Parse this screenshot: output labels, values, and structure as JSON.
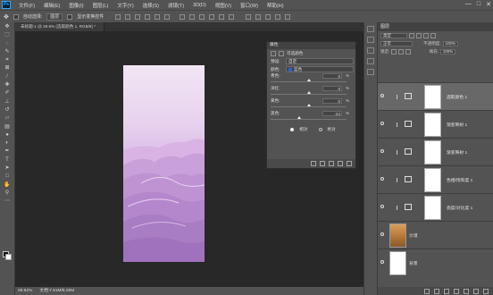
{
  "app": {
    "logo": "Ps"
  },
  "menubar": {
    "items": [
      "文件(F)",
      "编辑(E)",
      "图像(I)",
      "图层(L)",
      "文字(Y)",
      "选择(S)",
      "滤镜(T)",
      "3D(D)",
      "视图(V)",
      "窗口(W)",
      "帮助(H)"
    ],
    "window_controls": [
      "—",
      "□",
      "✕"
    ]
  },
  "options": {
    "auto_select_label": "自动选择:",
    "auto_select_value": "图层",
    "transform_label": "显示变换控件"
  },
  "document": {
    "tab_title": "未标题-1 @ 29.6% (选取颜色 1, RGB/8) *",
    "zoom": "29.62%",
    "doc_info": "文档:7.61M/8.28M"
  },
  "properties": {
    "title": "属性",
    "header_label": "可选颜色",
    "preset_label": "预设:",
    "preset_value": "自定",
    "color_label": "颜色:",
    "color_value": "蓝色",
    "color_swatch": "#2f5ed8",
    "sliders": [
      {
        "label": "青色:",
        "value": "0",
        "unit": "%",
        "level": 0
      },
      {
        "label": "洋红:",
        "value": "0",
        "unit": "%",
        "level": 0
      },
      {
        "label": "黄色:",
        "value": "0",
        "unit": "%",
        "level": 0
      },
      {
        "label": "黑色:",
        "value": "-24",
        "unit": "%",
        "level": -24
      }
    ],
    "method_relative": "相对",
    "method_absolute": "绝对"
  },
  "layers": {
    "tab": "图层",
    "kind_filter": "类型",
    "blend_mode": "正常",
    "opacity_label": "不透明度:",
    "opacity_value": "100%",
    "lock_label": "锁定:",
    "fill_label": "填充:",
    "fill_value": "100%",
    "items": [
      {
        "name": "选取颜色 1",
        "selected": true
      },
      {
        "name": "渐变映射 1",
        "selected": false
      },
      {
        "name": "渐变映射 1",
        "selected": false
      },
      {
        "name": "色相/饱和度 1",
        "selected": false
      },
      {
        "name": "亮度/对比度 1",
        "selected": false
      },
      {
        "name": "沙漠",
        "selected": false
      },
      {
        "name": "背景",
        "selected": false
      }
    ]
  }
}
